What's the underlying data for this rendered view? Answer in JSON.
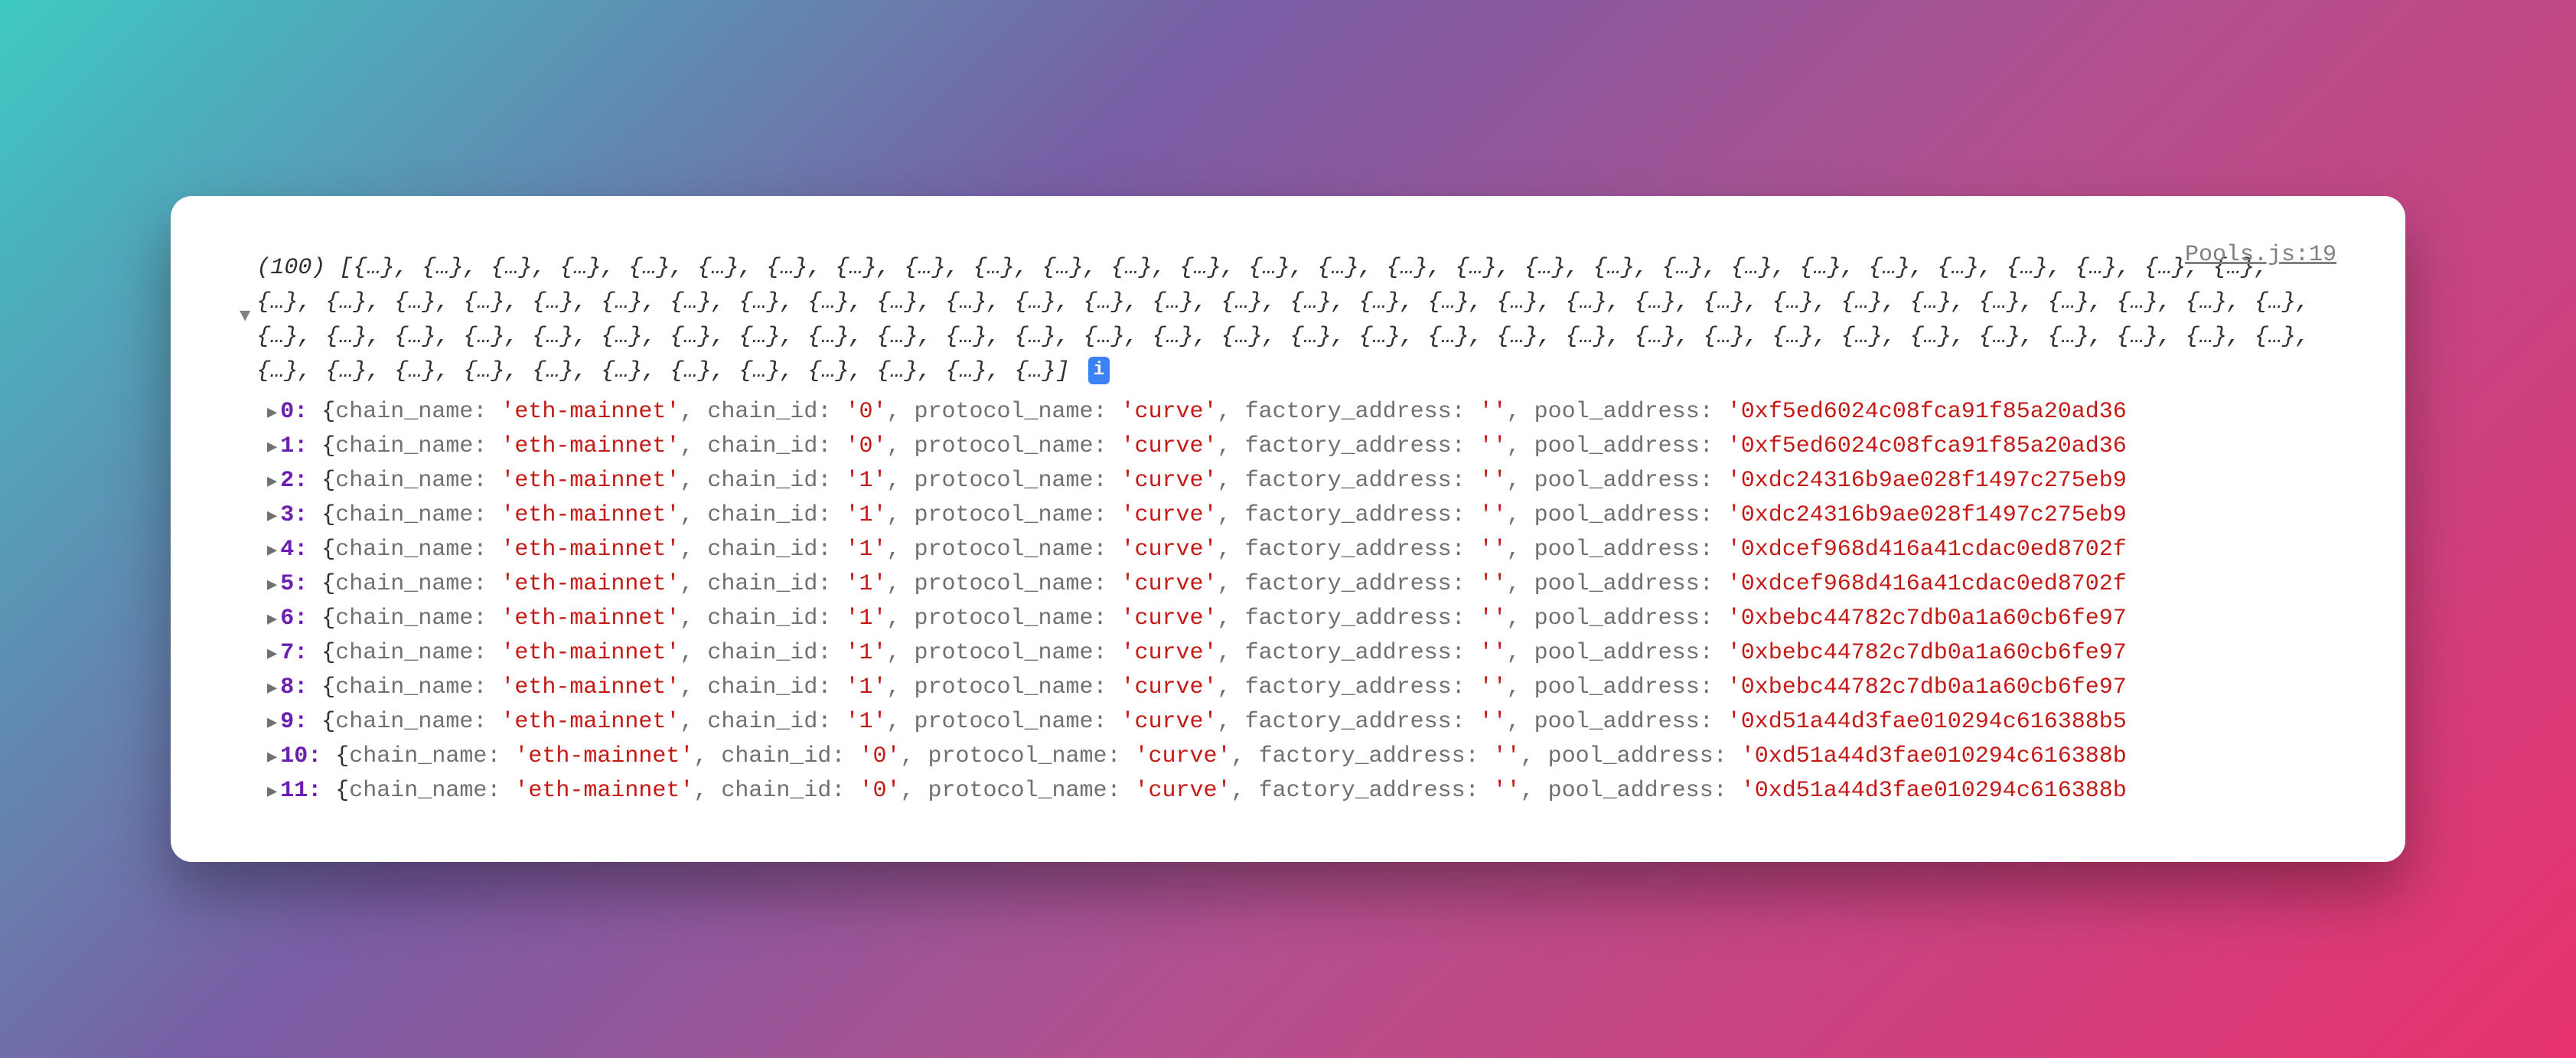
{
  "source_link": "Pools.js:19",
  "summary": {
    "count_label": "(100)",
    "placeholder": "{…}",
    "placeholder_count": 100,
    "info_symbol": "i"
  },
  "labels": {
    "chain_name": "chain_name",
    "chain_id": "chain_id",
    "protocol_name": "protocol_name",
    "factory_address": "factory_address",
    "pool_address": "pool_address"
  },
  "toggles": {
    "expanded_down": "▼",
    "collapsed_right": "▶"
  },
  "entries": [
    {
      "index": "0",
      "chain_name": "'eth-mainnet'",
      "chain_id": "'0'",
      "protocol_name": "'curve'",
      "factory_address": "''",
      "pool_address": "'0xf5ed6024c08fca91f85a20ad36"
    },
    {
      "index": "1",
      "chain_name": "'eth-mainnet'",
      "chain_id": "'0'",
      "protocol_name": "'curve'",
      "factory_address": "''",
      "pool_address": "'0xf5ed6024c08fca91f85a20ad36"
    },
    {
      "index": "2",
      "chain_name": "'eth-mainnet'",
      "chain_id": "'1'",
      "protocol_name": "'curve'",
      "factory_address": "''",
      "pool_address": "'0xdc24316b9ae028f1497c275eb9"
    },
    {
      "index": "3",
      "chain_name": "'eth-mainnet'",
      "chain_id": "'1'",
      "protocol_name": "'curve'",
      "factory_address": "''",
      "pool_address": "'0xdc24316b9ae028f1497c275eb9"
    },
    {
      "index": "4",
      "chain_name": "'eth-mainnet'",
      "chain_id": "'1'",
      "protocol_name": "'curve'",
      "factory_address": "''",
      "pool_address": "'0xdcef968d416a41cdac0ed8702f"
    },
    {
      "index": "5",
      "chain_name": "'eth-mainnet'",
      "chain_id": "'1'",
      "protocol_name": "'curve'",
      "factory_address": "''",
      "pool_address": "'0xdcef968d416a41cdac0ed8702f"
    },
    {
      "index": "6",
      "chain_name": "'eth-mainnet'",
      "chain_id": "'1'",
      "protocol_name": "'curve'",
      "factory_address": "''",
      "pool_address": "'0xbebc44782c7db0a1a60cb6fe97"
    },
    {
      "index": "7",
      "chain_name": "'eth-mainnet'",
      "chain_id": "'1'",
      "protocol_name": "'curve'",
      "factory_address": "''",
      "pool_address": "'0xbebc44782c7db0a1a60cb6fe97"
    },
    {
      "index": "8",
      "chain_name": "'eth-mainnet'",
      "chain_id": "'1'",
      "protocol_name": "'curve'",
      "factory_address": "''",
      "pool_address": "'0xbebc44782c7db0a1a60cb6fe97"
    },
    {
      "index": "9",
      "chain_name": "'eth-mainnet'",
      "chain_id": "'1'",
      "protocol_name": "'curve'",
      "factory_address": "''",
      "pool_address": "'0xd51a44d3fae010294c616388b5"
    },
    {
      "index": "10",
      "chain_name": "'eth-mainnet'",
      "chain_id": "'0'",
      "protocol_name": "'curve'",
      "factory_address": "''",
      "pool_address": "'0xd51a44d3fae010294c616388b"
    },
    {
      "index": "11",
      "chain_name": "'eth-mainnet'",
      "chain_id": "'0'",
      "protocol_name": "'curve'",
      "factory_address": "''",
      "pool_address": "'0xd51a44d3fae010294c616388b"
    }
  ]
}
